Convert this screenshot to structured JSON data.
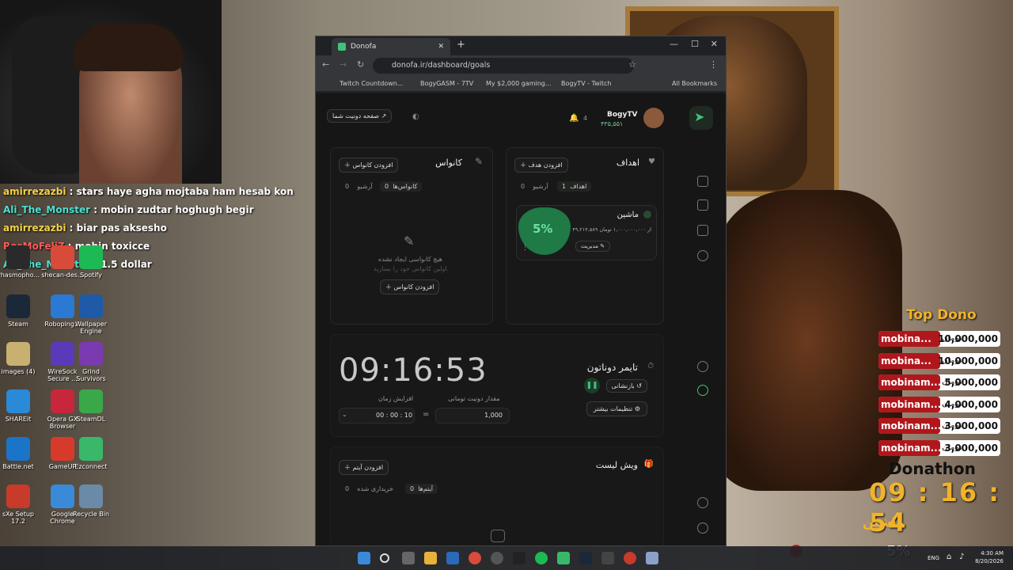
{
  "chat": [
    {
      "user": "amirrezazbi",
      "text": "stars haye agha mojtaba ham hesab kon",
      "color": "gold"
    },
    {
      "user": "Ali_The_Monster",
      "text": "mobin zudtar hoghugh begir",
      "color": "teal"
    },
    {
      "user": "amirrezazbi",
      "text": "biar pas aksesho",
      "color": "gold"
    },
    {
      "user": "RosMoFeliZ",
      "text": "mobin toxicce",
      "color": "red"
    },
    {
      "user": "Ali_The_Monster",
      "text": "1.5 dollar",
      "color": "teal"
    }
  ],
  "desktop_icons": [
    {
      "label": "Steam",
      "color": "#1b2838"
    },
    {
      "label": "Roboping...",
      "color": "#2a7ad3"
    },
    {
      "label": "Wallpaper Engine",
      "color": "#1e5aa8"
    },
    {
      "label": "images (4)",
      "color": "#c8b070"
    },
    {
      "label": "WireSock Secure ...",
      "color": "#5a3ab8"
    },
    {
      "label": "Grind Survivors",
      "color": "#7a3ab0"
    },
    {
      "label": "SHAREit",
      "color": "#2a8ad8"
    },
    {
      "label": "Opera GX Browser",
      "color": "#c8263a"
    },
    {
      "label": "SteamDL",
      "color": "#3aa848"
    },
    {
      "label": "Battle.net",
      "color": "#1a74c8"
    },
    {
      "label": "GameUP",
      "color": "#d83a2a"
    },
    {
      "label": "Ezconnect",
      "color": "#3ab86a"
    },
    {
      "label": "sXe Setup 17.2",
      "color": "#c83a2a"
    },
    {
      "label": "Google Chrome",
      "color": "#3a8ad8"
    },
    {
      "label": "Recycle Bin",
      "color": "#6a8aa8"
    },
    {
      "label": "Phasmopho...",
      "color": "#2a2a2a"
    },
    {
      "label": "shecan-des...",
      "color": "#d84a3a"
    },
    {
      "label": "Spotify",
      "color": "#1db954"
    }
  ],
  "browser": {
    "tab_title": "Donofa",
    "url": "donofa.ir/dashboard/goals",
    "bookmarks": [
      "Twitch Countdown...",
      "BogyGASM - 7TV",
      "My $2,000 gaming...",
      "BogyTV - Twitch",
      "All Bookmarks"
    ]
  },
  "dashboard": {
    "profile_name": "BogyTV",
    "profile_balance": "۴۳۵,۵۵۱",
    "notif_count": "4",
    "donate_page_btn": "صفحه دونیت شما",
    "goals": {
      "title": "اهداف",
      "add_btn": "افزودن هدف",
      "tab_goals": "اهداف",
      "tab_goals_count": "1",
      "tab_archive": "آرشیو",
      "tab_archive_count": "0",
      "goal_name": "ماشین",
      "goal_percent": "5%",
      "goal_amount": "۴۹,۲۱۴,۵۸۹ از ۱,۰۰۰,۰۰۰,۰۰۰ تومان",
      "manage_btn": "مدیریت"
    },
    "canvas": {
      "title": "کانواس",
      "add_btn": "افزودن کانواس",
      "tab_canvases": "کانواس‌ها",
      "tab_canvases_count": "0",
      "tab_archive": "آرشیو",
      "tab_archive_count": "0",
      "empty_title": "هیچ کانواسی ایجاد نشده",
      "empty_sub": "اولین کانواس خود را بسازید.",
      "empty_btn": "افزودن کانواس"
    },
    "timer": {
      "title": "تایمر دوناتون",
      "time": "09:16:53",
      "reset_btn": "بازنشانی",
      "more_settings": "تنظیمات بیشتر",
      "label_amount": "مقدار دونیت تومانی",
      "label_increase": "افزایش زمان",
      "amount_value": "1,000",
      "time_value": "00 : 00 : 10",
      "equals": "="
    },
    "wishlist": {
      "title": "ویش لیست",
      "add_btn": "افزودن آیتم",
      "tab_items": "آیتم‌ها",
      "tab_items_count": "0",
      "tab_bought": "خریداری شده",
      "tab_bought_count": "0"
    }
  },
  "overlay": {
    "top_dono_title": "Top Dono",
    "donations": [
      {
        "name": "mobina...",
        "currency": "تومان",
        "amount": "10,000,000"
      },
      {
        "name": "mobina...",
        "currency": "تومان",
        "amount": "10,000,000"
      },
      {
        "name": "mobinam...",
        "currency": "تومان",
        "amount": "5,000,000"
      },
      {
        "name": "mobinam...",
        "currency": "تومان",
        "amount": "4,000,000"
      },
      {
        "name": "mobinam...",
        "currency": "تومان",
        "amount": "3,000,000"
      },
      {
        "name": "mobinam...",
        "currency": "تومان",
        "amount": "3,000,000"
      }
    ],
    "donathon_title": "Donathon",
    "donathon_timer": "09 : 16 : 54",
    "goal_name": "ماشین",
    "goal_percent": "5%"
  },
  "taskbar": {
    "lang": "ENG",
    "time": "4:30 AM",
    "date": "8/20/2026"
  }
}
